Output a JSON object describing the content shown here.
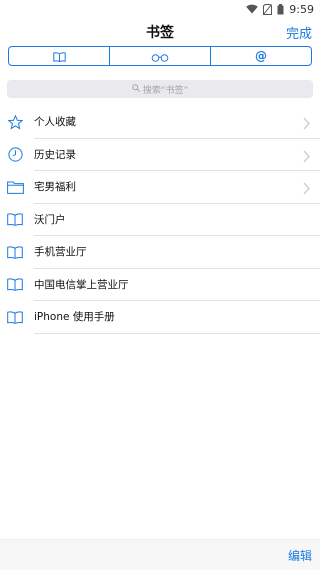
{
  "status": {
    "time": "9:59"
  },
  "nav": {
    "title": "书签",
    "done_label": "完成"
  },
  "segments": [
    {
      "icon": "book-icon"
    },
    {
      "icon": "glasses-icon"
    },
    {
      "label": "@"
    }
  ],
  "search": {
    "placeholder": "搜索“书签”"
  },
  "rows": [
    {
      "label": "个人收藏",
      "icon": "star-icon"
    },
    {
      "label": "历史记录",
      "icon": "clock-icon"
    },
    {
      "label": "宅男福利",
      "icon": "folder-icon"
    },
    {
      "label": "沃门户",
      "icon": "book-icon"
    },
    {
      "label": "手机营业厅",
      "icon": "book-icon"
    },
    {
      "label": "中国电信掌上营业厅",
      "icon": "book-icon"
    },
    {
      "label": "iPhone 使用手册",
      "icon": "book-icon"
    }
  ],
  "toolbar": {
    "edit_label": "编辑"
  },
  "colors": {
    "accent": "#1a7be0"
  }
}
